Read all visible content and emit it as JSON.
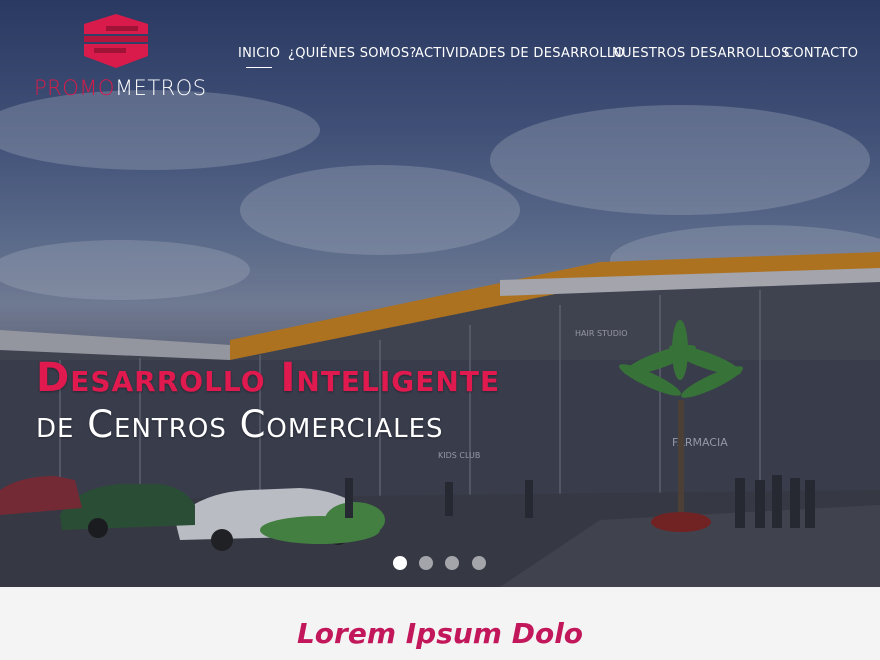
{
  "brand": {
    "logo_part1": "PROMO",
    "logo_part2": "METROS",
    "accent_color": "#d81b4a"
  },
  "nav": {
    "items": [
      {
        "label": "INICIO",
        "active": true
      },
      {
        "label": "¿QUIÉNES SOMOS?",
        "active": false
      },
      {
        "label": "ACTIVIDADES DE DESARROLLO",
        "active": false
      },
      {
        "label": "NUESTROS DESARROLLOS",
        "active": false
      },
      {
        "label": "CONTACTO",
        "active": false
      }
    ]
  },
  "hero": {
    "headline_line1": "Desarrollo Inteligente",
    "headline_line2": "de Centros Comerciales",
    "signage": [
      "FARMACIA",
      "KIDS CLUB",
      "HAIR STUDIO"
    ],
    "slides_total": 4,
    "slide_active": 1
  },
  "section": {
    "title": "Lorem Ipsum Dolo"
  }
}
